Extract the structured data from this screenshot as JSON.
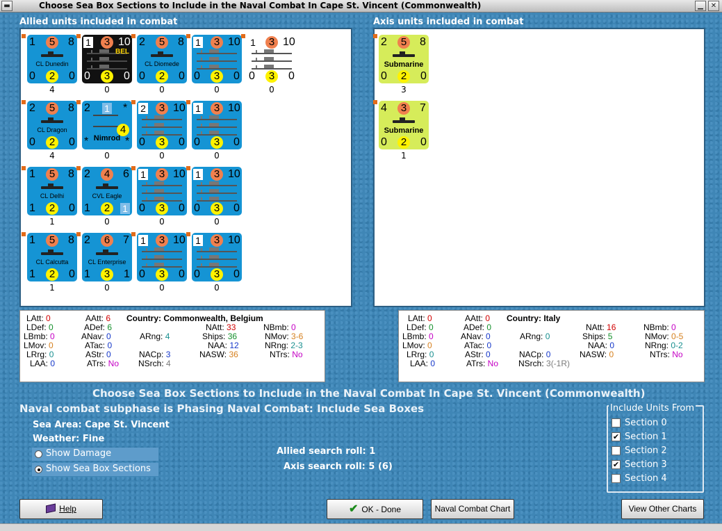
{
  "window": {
    "title": "Choose Sea Box Sections to Include in the Naval Combat In Cape St. Vincent (Commonwealth)"
  },
  "allied": {
    "label": "Allied units included in combat",
    "counters": [
      {
        "type": "blue",
        "a": "1",
        "b": "5",
        "c": "8",
        "name": "CL Dunedin",
        "d": "0",
        "e": "2",
        "f": "0",
        "under": "4"
      },
      {
        "type": "black",
        "a": "1",
        "b": "3",
        "c": "10",
        "name": "BEL",
        "d": "0",
        "e": "3",
        "f": "0",
        "under": "0"
      },
      {
        "type": "blue",
        "a": "2",
        "b": "5",
        "c": "8",
        "name": "CL Diomede",
        "d": "0",
        "e": "2",
        "f": "0",
        "under": "0"
      },
      {
        "type": "fleet",
        "a": "1",
        "b": "3",
        "c": "10",
        "name": "",
        "d": "0",
        "e": "3",
        "f": "0",
        "under": "0"
      },
      {
        "type": "white",
        "a": "1",
        "b": "3",
        "c": "10",
        "name": "",
        "d": "0",
        "e": "3",
        "f": "0",
        "under": "0"
      },
      {
        "type": "blue",
        "a": "2",
        "b": "5",
        "c": "8",
        "name": "CL Dragon",
        "d": "0",
        "e": "2",
        "f": "0",
        "under": "4"
      },
      {
        "type": "air",
        "a": "2",
        "b": "1",
        "c": "*",
        "name": "Nimrod",
        "d": "*",
        "e": "4",
        "f": "*",
        "under": "0"
      },
      {
        "type": "fleet",
        "a": "2",
        "b": "3",
        "c": "10",
        "name": "",
        "d": "0",
        "e": "3",
        "f": "0",
        "under": "0"
      },
      {
        "type": "fleet",
        "a": "1",
        "b": "3",
        "c": "10",
        "name": "",
        "d": "0",
        "e": "3",
        "f": "0",
        "under": "0"
      },
      {
        "type": "blue",
        "a": "1",
        "b": "5",
        "c": "8",
        "name": "CL Delhi",
        "d": "1",
        "e": "2",
        "f": "0",
        "under": "1"
      },
      {
        "type": "blue",
        "a": "2",
        "b": "4",
        "c": "6",
        "name": "CVL Eagle",
        "d": "1",
        "e": "2",
        "f": "1",
        "under": "0"
      },
      {
        "type": "fleet",
        "a": "1",
        "b": "3",
        "c": "10",
        "name": "",
        "d": "0",
        "e": "3",
        "f": "0",
        "under": "0"
      },
      {
        "type": "fleet",
        "a": "1",
        "b": "3",
        "c": "10",
        "name": "",
        "d": "0",
        "e": "3",
        "f": "0",
        "under": "0"
      },
      {
        "type": "blue",
        "a": "1",
        "b": "5",
        "c": "8",
        "name": "CL Calcutta",
        "d": "1",
        "e": "2",
        "f": "0",
        "under": "1"
      },
      {
        "type": "blue",
        "a": "2",
        "b": "6",
        "c": "7",
        "name": "CL Enterprise",
        "d": "1",
        "e": "3",
        "f": "1",
        "under": "0"
      },
      {
        "type": "fleet",
        "a": "1",
        "b": "3",
        "c": "10",
        "name": "",
        "d": "0",
        "e": "3",
        "f": "0",
        "under": "0"
      },
      {
        "type": "fleet",
        "a": "1",
        "b": "3",
        "c": "10",
        "name": "",
        "d": "0",
        "e": "3",
        "f": "0",
        "under": "0"
      }
    ],
    "stats": {
      "LAtt": "0",
      "LDef": "0",
      "LBmb": "0",
      "LMov": "0",
      "LRrg": "0",
      "LAA": "0",
      "AAtt": "6",
      "ADef": "6",
      "ANav": "0",
      "ATac": "0",
      "AStr": "0",
      "ATrs": "No",
      "country_label": "Country:",
      "country": "Commonwealth, Belgium",
      "ARng": "4",
      "NAtt": "33",
      "Ships": "36",
      "NAA": "12",
      "NASW": "36",
      "NACp": "3",
      "NSrch": "4",
      "NBmb": "0",
      "NMov": "3-6",
      "NRng": "2-3",
      "NTrs": "No"
    }
  },
  "axis": {
    "label": "Axis units included in combat",
    "counters": [
      {
        "type": "sub",
        "a": "2",
        "b": "5",
        "c": "8",
        "name": "Submarine",
        "d": "0",
        "e": "2",
        "f": "0",
        "under": "3"
      },
      {
        "type": "sub",
        "a": "4",
        "b": "3",
        "c": "7",
        "name": "Submarine",
        "d": "0",
        "e": "2",
        "f": "0",
        "under": "1"
      }
    ],
    "stats": {
      "LAtt": "0",
      "LDef": "0",
      "LBmb": "0",
      "LMov": "0",
      "LRrg": "0",
      "LAA": "0",
      "AAtt": "0",
      "ADef": "0",
      "ANav": "0",
      "ATac": "0",
      "AStr": "0",
      "ATrs": "No",
      "country_label": "Country:",
      "country": "Italy",
      "ARng": "0",
      "NAtt": "16",
      "Ships": "5",
      "NAA": "0",
      "NASW": "0",
      "NACp": "0",
      "NSrch": "3(-1R)",
      "NBmb": "0",
      "NMov": "0-5",
      "NRng": "0-2",
      "NTrs": "No"
    }
  },
  "main": {
    "heading": "Choose Sea Box Sections to Include in the Naval Combat In Cape St. Vincent (Commonwealth)",
    "subphase": "Naval combat subphase is Phasing Naval Combat: Include Sea Boxes",
    "sea_area_label": "Sea Area:",
    "sea_area": "Cape St. Vincent",
    "weather_label": "Weather:",
    "weather": "Fine",
    "allied_search": "Allied search roll: 1",
    "axis_search": "Axis search roll: 5 (6)",
    "show_damage": "Show Damage",
    "show_sections": "Show Sea Box Sections"
  },
  "include": {
    "legend": "Include Units From",
    "sections": [
      {
        "label": "Section 0",
        "checked": false
      },
      {
        "label": "Section 1",
        "checked": true
      },
      {
        "label": "Section 2",
        "checked": false
      },
      {
        "label": "Section 3",
        "checked": true
      },
      {
        "label": "Section 4",
        "checked": false
      }
    ]
  },
  "buttons": {
    "help": "Help",
    "ok": "OK - Done",
    "chart": "Naval Combat Chart",
    "other": "View Other Charts"
  }
}
